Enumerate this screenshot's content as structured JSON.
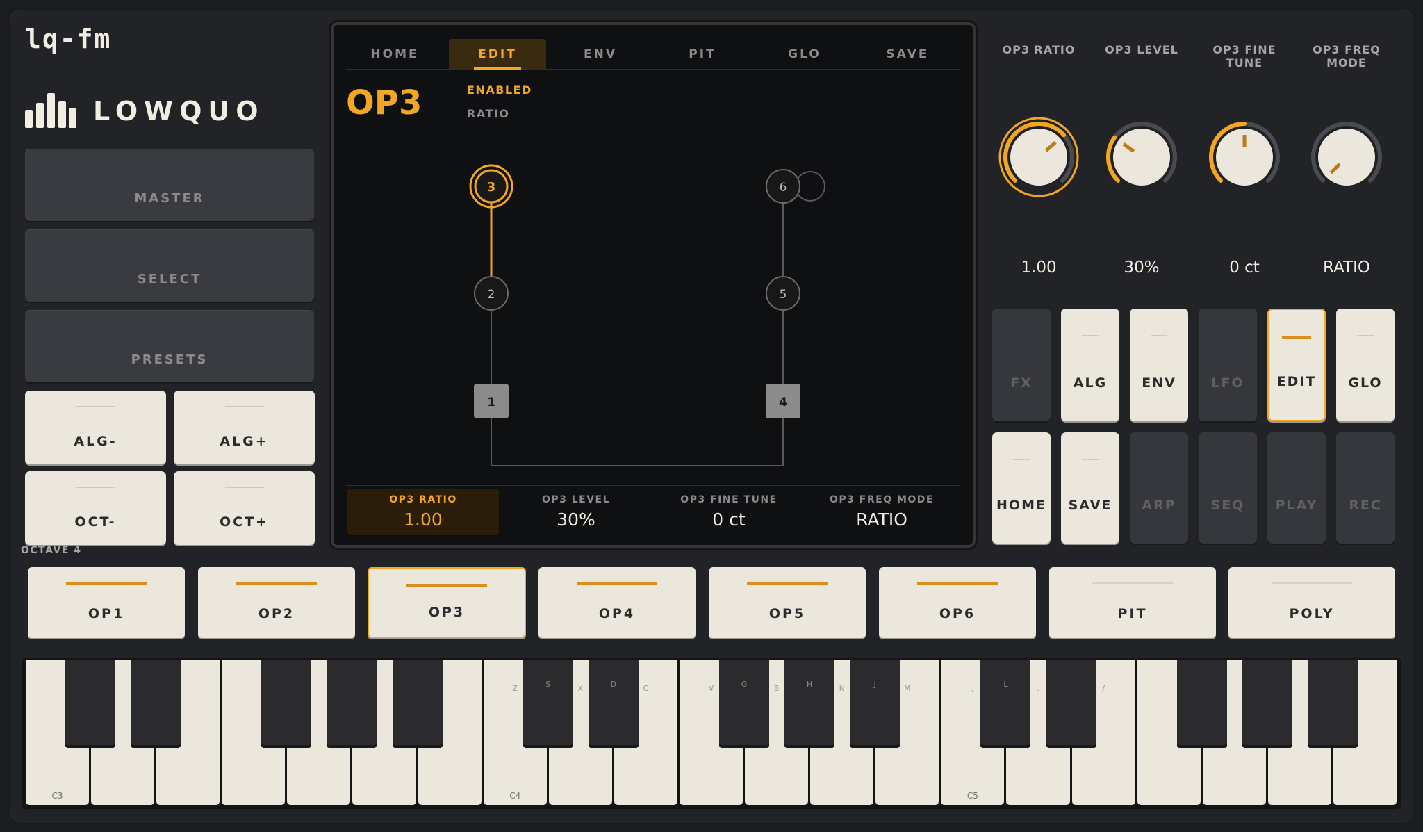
{
  "app": {
    "title": "lq-fm",
    "brand": "LOWQUO"
  },
  "colors": {
    "accent": "#f2a623",
    "panel": "#222327",
    "cream": "#ebe7dc"
  },
  "left": {
    "nav": [
      "MASTER",
      "SELECT",
      "PRESETS"
    ],
    "alg_minus": "ALG-",
    "alg_plus": "ALG+",
    "oct_minus": "OCT-",
    "oct_plus": "OCT+"
  },
  "screen": {
    "tabs": [
      "HOME",
      "EDIT",
      "ENV",
      "PIT",
      "GLO",
      "SAVE"
    ],
    "active_tab": "EDIT",
    "op_title": "OP3",
    "enabled": "ENABLED",
    "mode_label": "RATIO",
    "operators": [
      "3",
      "6",
      "2",
      "5",
      "1",
      "4"
    ],
    "params": [
      {
        "label": "OP3 RATIO",
        "value": "1.00"
      },
      {
        "label": "OP3 LEVEL",
        "value": "30%"
      },
      {
        "label": "OP3 FINE TUNE",
        "value": "0 ct"
      },
      {
        "label": "OP3 FREQ MODE",
        "value": "RATIO"
      }
    ]
  },
  "knobs": [
    {
      "label": "OP3 RATIO",
      "value": "1.00",
      "level": 0.68
    },
    {
      "label": "OP3 LEVEL",
      "value": "30%",
      "level": 0.3
    },
    {
      "label": "OP3 FINE TUNE",
      "value": "0 ct",
      "level": 0.5
    },
    {
      "label": "OP3 FREQ MODE",
      "value": "RATIO",
      "level": 0.0
    }
  ],
  "pads_row1": [
    "FX",
    "ALG",
    "ENV",
    "LFO",
    "EDIT",
    "GLO"
  ],
  "pads_row2": [
    "HOME",
    "SAVE",
    "ARP",
    "SEQ",
    "PLAY",
    "REC"
  ],
  "octave_label": "OCTAVE 4",
  "op_buttons": [
    "OP1",
    "OP2",
    "OP3",
    "OP4",
    "OP5",
    "OP6",
    "PIT",
    "POLY"
  ],
  "keyboard": {
    "octave_labels": [
      "C3",
      "C4",
      "C5"
    ],
    "white_hotkeys": [
      "Z",
      "X",
      "C",
      "V",
      "B",
      "N",
      "M",
      ",",
      ".",
      "/"
    ],
    "black_hotkeys": [
      "S",
      "D",
      "G",
      "H",
      "J",
      "L",
      ";"
    ]
  }
}
